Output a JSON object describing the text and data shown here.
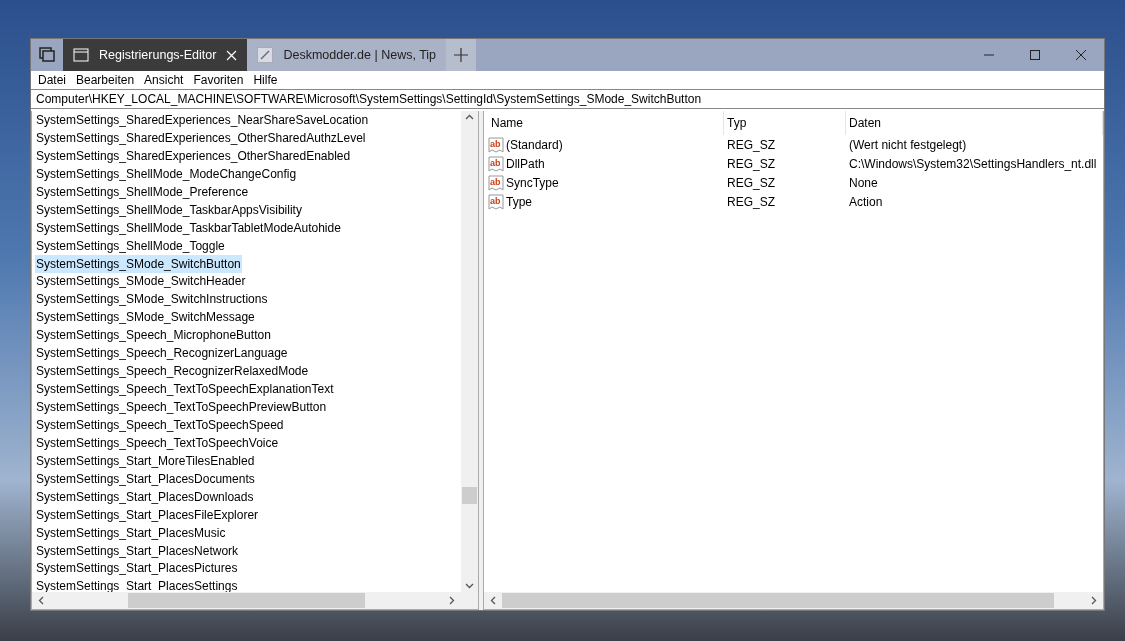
{
  "window": {
    "tabs": [
      {
        "label": "Registrierungs-Editor",
        "selected": true,
        "kind": "window"
      },
      {
        "label": "Deskmodder.de | News, Tip",
        "selected": false,
        "kind": "pen"
      }
    ]
  },
  "menu": [
    "Datei",
    "Bearbeiten",
    "Ansicht",
    "Favoriten",
    "Hilfe"
  ],
  "address": "Computer\\HKEY_LOCAL_MACHINE\\SOFTWARE\\Microsoft\\SystemSettings\\SettingId\\SystemSettings_SMode_SwitchButton",
  "tree": {
    "items": [
      {
        "label": "SystemSettings_SharedExperiences_NearShareSaveLocation",
        "selected": false
      },
      {
        "label": "SystemSettings_SharedExperiences_OtherSharedAuthzLevel",
        "selected": false
      },
      {
        "label": "SystemSettings_SharedExperiences_OtherSharedEnabled",
        "selected": false
      },
      {
        "label": "SystemSettings_ShellMode_ModeChangeConfig",
        "selected": false
      },
      {
        "label": "SystemSettings_ShellMode_Preference",
        "selected": false
      },
      {
        "label": "SystemSettings_ShellMode_TaskbarAppsVisibility",
        "selected": false
      },
      {
        "label": "SystemSettings_ShellMode_TaskbarTabletModeAutohide",
        "selected": false
      },
      {
        "label": "SystemSettings_ShellMode_Toggle",
        "selected": false
      },
      {
        "label": "SystemSettings_SMode_SwitchButton",
        "selected": true
      },
      {
        "label": "SystemSettings_SMode_SwitchHeader",
        "selected": false
      },
      {
        "label": "SystemSettings_SMode_SwitchInstructions",
        "selected": false
      },
      {
        "label": "SystemSettings_SMode_SwitchMessage",
        "selected": false
      },
      {
        "label": "SystemSettings_Speech_MicrophoneButton",
        "selected": false
      },
      {
        "label": "SystemSettings_Speech_RecognizerLanguage",
        "selected": false
      },
      {
        "label": "SystemSettings_Speech_RecognizerRelaxedMode",
        "selected": false
      },
      {
        "label": "SystemSettings_Speech_TextToSpeechExplanationText",
        "selected": false
      },
      {
        "label": "SystemSettings_Speech_TextToSpeechPreviewButton",
        "selected": false
      },
      {
        "label": "SystemSettings_Speech_TextToSpeechSpeed",
        "selected": false
      },
      {
        "label": "SystemSettings_Speech_TextToSpeechVoice",
        "selected": false
      },
      {
        "label": "SystemSettings_Start_MoreTilesEnabled",
        "selected": false
      },
      {
        "label": "SystemSettings_Start_PlacesDocuments",
        "selected": false
      },
      {
        "label": "SystemSettings_Start_PlacesDownloads",
        "selected": false
      },
      {
        "label": "SystemSettings_Start_PlacesFileExplorer",
        "selected": false
      },
      {
        "label": "SystemSettings_Start_PlacesMusic",
        "selected": false
      },
      {
        "label": "SystemSettings_Start_PlacesNetwork",
        "selected": false
      },
      {
        "label": "SystemSettings_Start_PlacesPictures",
        "selected": false
      },
      {
        "label": "SystemSettings_Start_PlacesSettings",
        "selected": false
      }
    ]
  },
  "values": {
    "columns": [
      "Name",
      "Typ",
      "Daten"
    ],
    "rows": [
      {
        "icon": "ab",
        "name": "(Standard)",
        "type": "REG_SZ",
        "data": "(Wert nicht festgelegt)"
      },
      {
        "icon": "ab",
        "name": "DllPath",
        "type": "REG_SZ",
        "data": "C:\\Windows\\System32\\SettingsHandlers_nt.dll"
      },
      {
        "icon": "ab",
        "name": "SyncType",
        "type": "REG_SZ",
        "data": "None"
      },
      {
        "icon": "ab",
        "name": "Type",
        "type": "REG_SZ",
        "data": "Action"
      }
    ]
  }
}
